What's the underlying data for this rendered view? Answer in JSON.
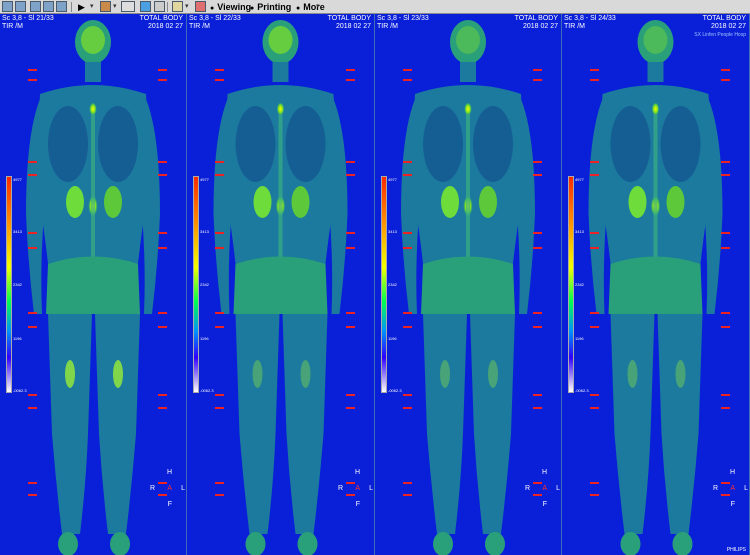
{
  "toolbar": {
    "menus": [
      {
        "label": "Viewing"
      },
      {
        "label": "Printing"
      },
      {
        "label": "More"
      }
    ],
    "icons": [
      "layout-1x1-icon",
      "layout-grid-icon",
      "layout-columns-icon",
      "layout-stack-icon",
      "play-icon",
      "window-level-icon",
      "ruler-icon",
      "pin-icon",
      "cine-icon",
      "report-icon",
      "reset-icon"
    ]
  },
  "viewports": [
    {
      "series": "Sc 3,8 - Sl 21/33",
      "mode": "TIR  /M",
      "body": "TOTAL BODY",
      "date": "2018 02 27",
      "hospital": "",
      "show_orient": false,
      "show_vendor": false
    },
    {
      "series": "Sc 3,8 - Sl 22/33",
      "mode": "TIR  /M",
      "body": "TOTAL BODY",
      "date": "2018 02 27",
      "hospital": "",
      "show_orient": true,
      "show_vendor": false
    },
    {
      "series": "Sc 3,8 - Sl 23/33",
      "mode": "TIR  /M",
      "body": "TOTAL BODY",
      "date": "2018 02 27",
      "hospital": "",
      "show_orient": true,
      "show_vendor": false
    },
    {
      "series": "Sc 3,8 - Sl 24/33",
      "mode": "TIR  /M",
      "body": "TOTAL BODY",
      "date": "2018 02 27",
      "hospital": "SX Linfen People Hosp",
      "show_orient": true,
      "show_vendor": true
    }
  ],
  "colorbar_ticks": [
    "4977",
    "3413",
    "2342",
    "1196",
    "-0062.3"
  ],
  "orientation": {
    "superior": "H",
    "right": "R",
    "anterior": "A",
    "left": "L",
    "inferior": "F"
  },
  "vendor": "PHILIPS",
  "colors": {
    "background": "#0a1fd8",
    "body": "#1a7ca0",
    "highlight": "#f3f000",
    "marker": "#e22222"
  }
}
